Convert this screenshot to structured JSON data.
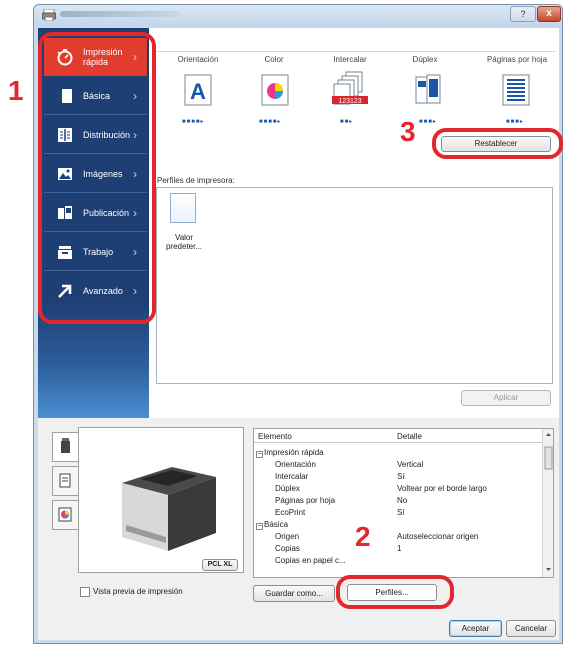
{
  "window": {
    "help_label": "?",
    "close_label": "x"
  },
  "nav": {
    "items": [
      {
        "label": "Impresión rápida",
        "icon": "quick-print-stopwatch-icon"
      },
      {
        "label": "Básica",
        "icon": "page-icon"
      },
      {
        "label": "Distribución",
        "icon": "layout-icon"
      },
      {
        "label": "Imágenes",
        "icon": "image-icon"
      },
      {
        "label": "Publicación",
        "icon": "publishing-icon"
      },
      {
        "label": "Trabajo",
        "icon": "job-icon"
      },
      {
        "label": "Avanzado",
        "icon": "arrow-icon"
      }
    ],
    "active_index": 0
  },
  "quick_print": {
    "columns": [
      {
        "label": "Orientación",
        "icon": "orientation-icon"
      },
      {
        "label": "Color",
        "icon": "color-icon"
      },
      {
        "label": "Intercalar",
        "icon": "collate-icon"
      },
      {
        "label": "Dúplex",
        "icon": "duplex-icon"
      },
      {
        "label": "Páginas por hoja",
        "icon": "pages-per-sheet-icon"
      }
    ],
    "orientation_letter": "A",
    "collate_numbers": "123123"
  },
  "reset_label": "Restablecer",
  "profiles": {
    "label": "Perfiles de impresora:",
    "item_caption": "Valor predeter..."
  },
  "apply_label": "Aplicar",
  "steps": {
    "one": "1",
    "two": "2",
    "three": "3"
  },
  "preview": {
    "pdl_badge": "PCL XL",
    "checkbox_label": "Vista previa de impresión",
    "checkbox_checked": false
  },
  "settings_table": {
    "headers": [
      "Elemento",
      "Detalle"
    ],
    "rows": [
      {
        "el": "Impresión rápida",
        "dt": "",
        "group": true
      },
      {
        "el": "Orientación",
        "dt": "Vertical",
        "group": false
      },
      {
        "el": "Intercalar",
        "dt": "Sí",
        "group": false
      },
      {
        "el": "Dúplex",
        "dt": "Voltear por el borde largo",
        "group": false
      },
      {
        "el": "Páginas por hoja",
        "dt": "No",
        "group": false
      },
      {
        "el": "EcoPrint",
        "dt": "Sí",
        "group": false
      },
      {
        "el": "Básica",
        "dt": "",
        "group": true
      },
      {
        "el": "Origen",
        "dt": "Autoseleccionar origen",
        "group": false
      },
      {
        "el": "Copias",
        "dt": "1",
        "group": false
      },
      {
        "el": "Copias en papel c...",
        "dt": "",
        "group": false
      }
    ]
  },
  "buttons": {
    "save_as": "Guardar como...",
    "profiles": "Perfiles...",
    "accept": "Aceptar",
    "cancel": "Cancelar"
  },
  "colors": {
    "nav_bg": "#1e3f73",
    "nav_active": "#e23c2f",
    "highlight": "#e3272d",
    "accent_blue": "#1a56a8"
  }
}
